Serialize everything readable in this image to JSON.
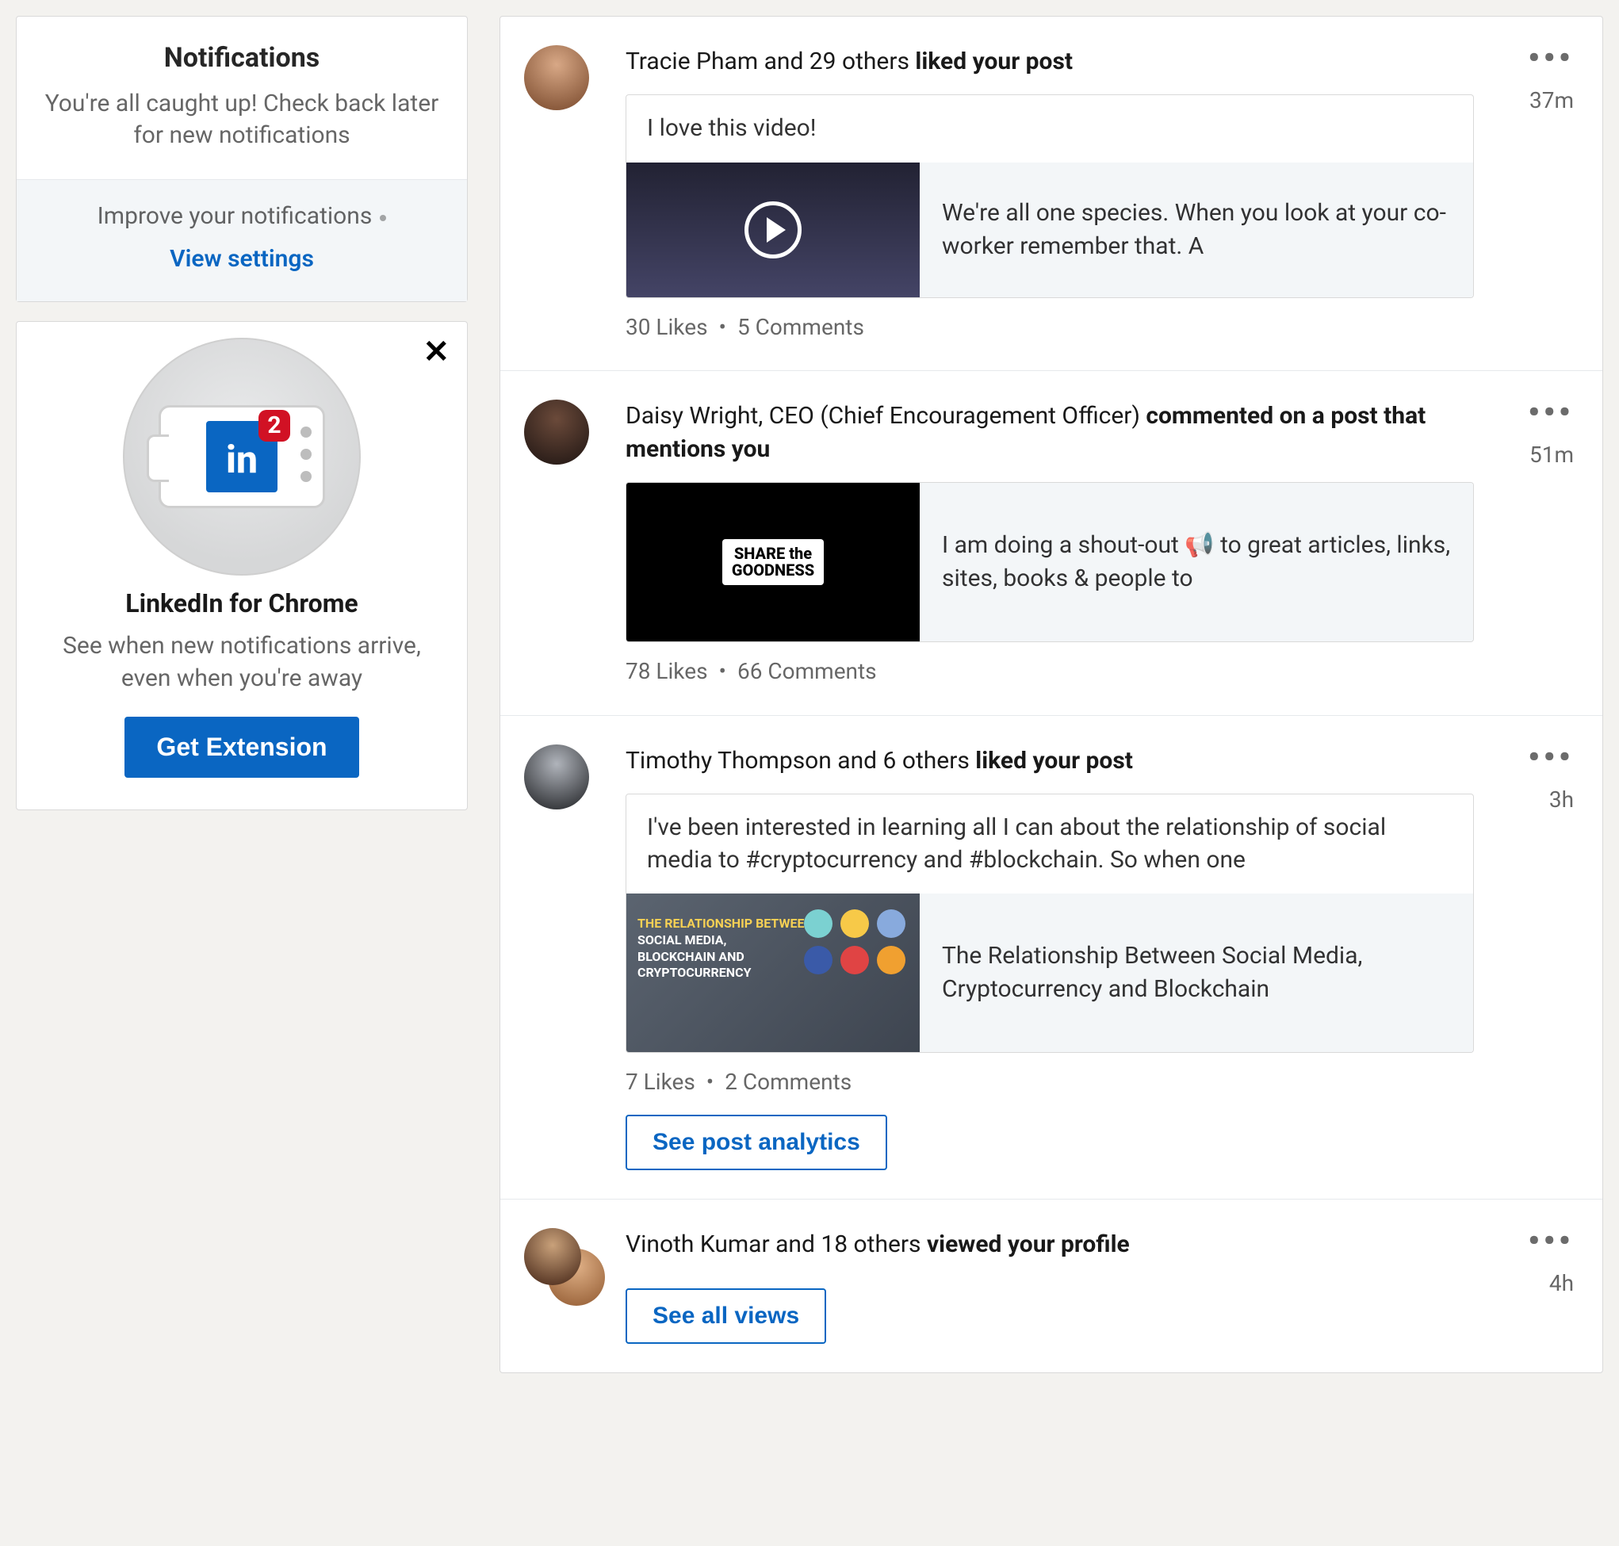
{
  "sidebar": {
    "notif": {
      "title": "Notifications",
      "msg": "You're all caught up! Check back later for new notifications",
      "improve": "Improve your notifications",
      "view_settings": "View settings"
    },
    "ext": {
      "badge": "2",
      "title": "LinkedIn for Chrome",
      "desc": "See when new notifications arrive, even when you're away",
      "button": "Get Extension"
    }
  },
  "feed": [
    {
      "prefix": "Tracie Pham and 29 others ",
      "action": "liked your post",
      "time": "37m",
      "post_text": "I love this video!",
      "caption": "We're all one species. When you look at your co-worker remember that.  A",
      "likes": "30 Likes",
      "comments": "5 Comments"
    },
    {
      "prefix": "Daisy Wright, CEO (Chief Encouragement Officer) ",
      "action": "commented on a post that mentions you",
      "time": "51m",
      "share_top": "SHARE the",
      "share_bot": "GOODNESS",
      "caption": "I am doing a shout-out 📢 to great articles, links, sites, books & people to",
      "likes": "78 Likes",
      "comments": "66 Comments"
    },
    {
      "prefix": "Timothy Thompson and 6 others ",
      "action": "liked your post",
      "time": "3h",
      "post_text": "I've been interested in learning all I can about the relationship of social media to #cryptocurrency and #blockchain. So when one",
      "thumb_l1": "THE RELATIONSHIP BETWEEN",
      "thumb_l2": "SOCIAL MEDIA,",
      "thumb_l3": "BLOCKCHAIN AND",
      "thumb_l4": "CRYPTOCURRENCY",
      "caption": "The Relationship Between Social Media, Cryptocurrency and Blockchain",
      "likes": "7 Likes",
      "comments": "2 Comments",
      "analytics": "See post analytics"
    },
    {
      "prefix": "Vinoth Kumar and 18 others ",
      "action": "viewed your profile",
      "time": "4h",
      "see_all": "See all views"
    }
  ]
}
